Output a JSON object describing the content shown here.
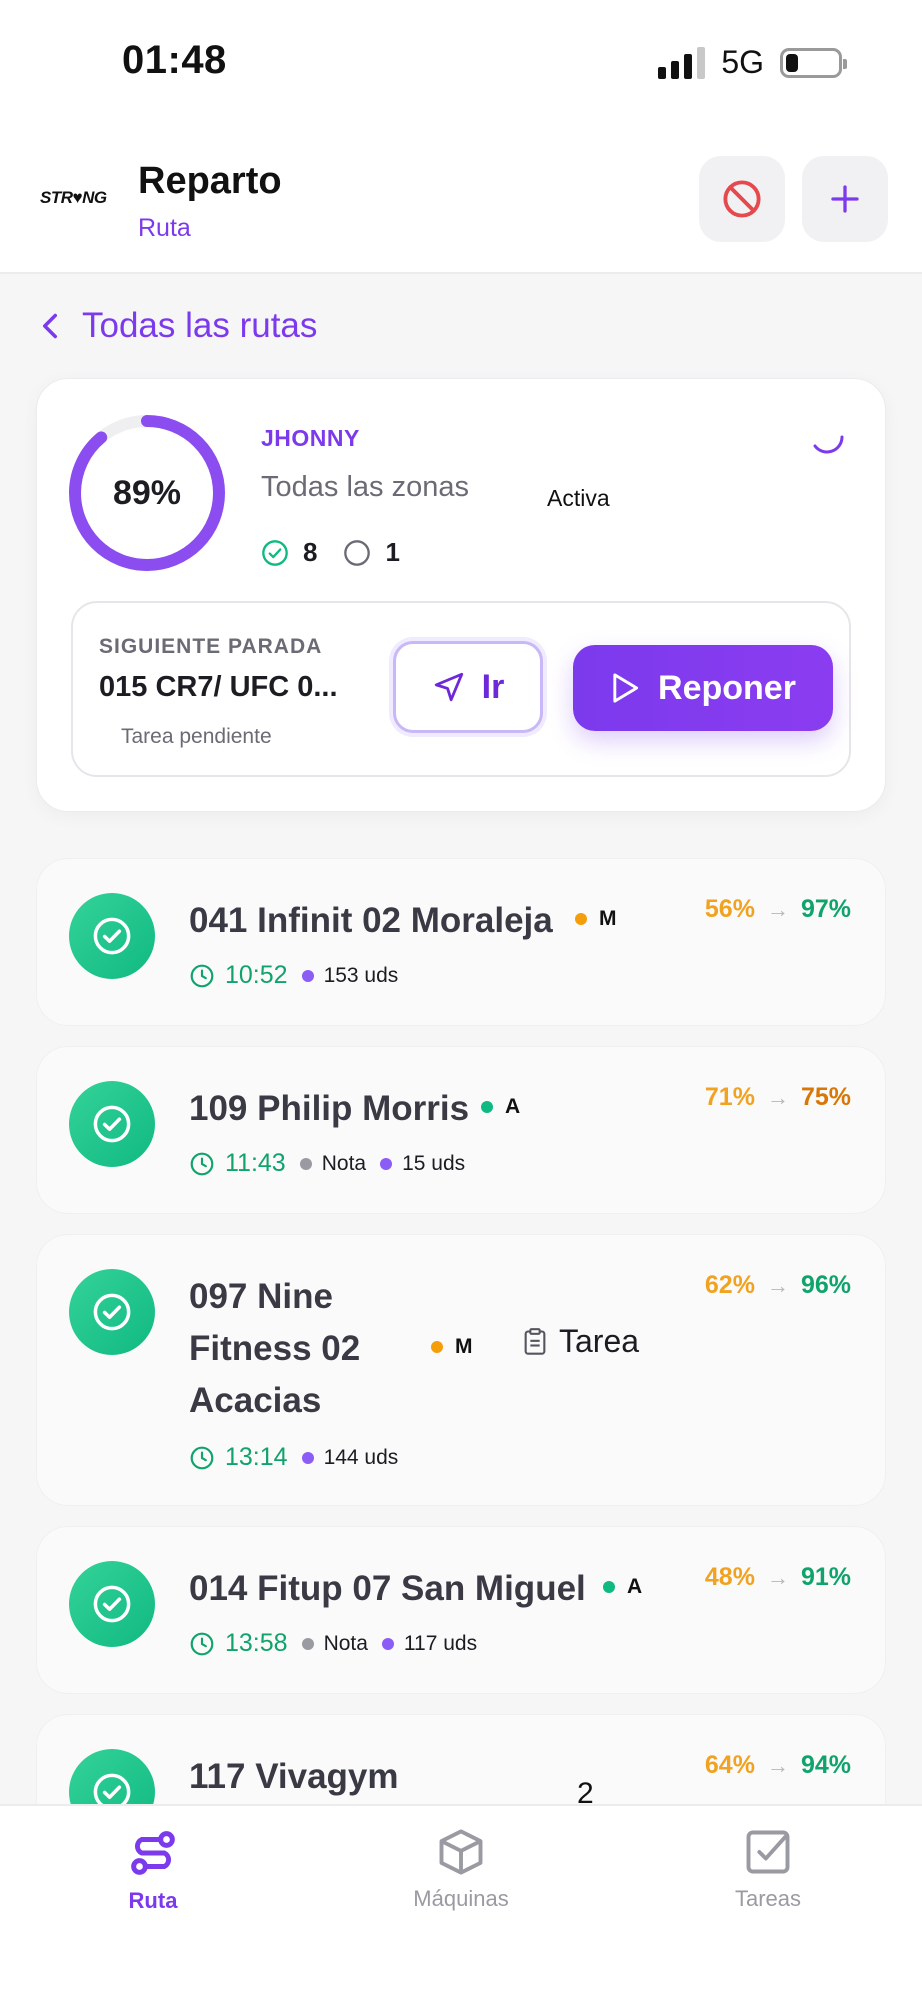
{
  "status_bar": {
    "time": "01:48",
    "network": "5G"
  },
  "header": {
    "logo_text": "STR♥NG",
    "title": "Reparto",
    "subtitle": "Ruta"
  },
  "back_link": {
    "label": "Todas las rutas"
  },
  "summary": {
    "progress_percent": 89,
    "progress_label": "89%",
    "driver": "JHONNY",
    "zones": "Todas las zonas",
    "status": "Activa",
    "done_count": "8",
    "pending_count": "1",
    "next_stop": {
      "label": "SIGUIENTE PARADA",
      "name": "015 CR7/ UFC 0...",
      "task": "Tarea pendiente",
      "go_label": "Ir",
      "restock_label": "Reponer"
    }
  },
  "stops": [
    {
      "name": "041 Infinit 02 Moraleja",
      "tag": "M",
      "tag_color": "#f59e0b",
      "from_pct": "56%",
      "to_pct": "97%",
      "time": "10:52",
      "note": "",
      "units": "153 uds"
    },
    {
      "name": "109 Philip Morris",
      "tag": "A",
      "tag_color": "#10b981",
      "from_pct": "71%",
      "to_pct": "75%",
      "time": "11:43",
      "note": "Nota",
      "units": "15 uds"
    },
    {
      "name_lines": [
        "097 Nine",
        "Fitness 02",
        "Acacias"
      ],
      "tag": "M",
      "tag_color": "#f59e0b",
      "task": "Tarea",
      "from_pct": "62%",
      "to_pct": "96%",
      "time": "13:14",
      "note": "",
      "units": "144 uds"
    },
    {
      "name": "014 Fitup 07 San Miguel",
      "tag": "A",
      "tag_color": "#10b981",
      "from_pct": "48%",
      "to_pct": "91%",
      "time": "13:58",
      "note": "Nota",
      "units": "117 uds"
    },
    {
      "name": "117 Vivagym",
      "partial_text": "2",
      "from_pct": "64%",
      "to_pct": "94%"
    }
  ],
  "bottom_nav": [
    {
      "label": "Ruta",
      "icon": "route-icon",
      "active": true
    },
    {
      "label": "Máquinas",
      "icon": "box-icon",
      "active": false
    },
    {
      "label": "Tareas",
      "icon": "checkbox-icon",
      "active": false
    }
  ]
}
